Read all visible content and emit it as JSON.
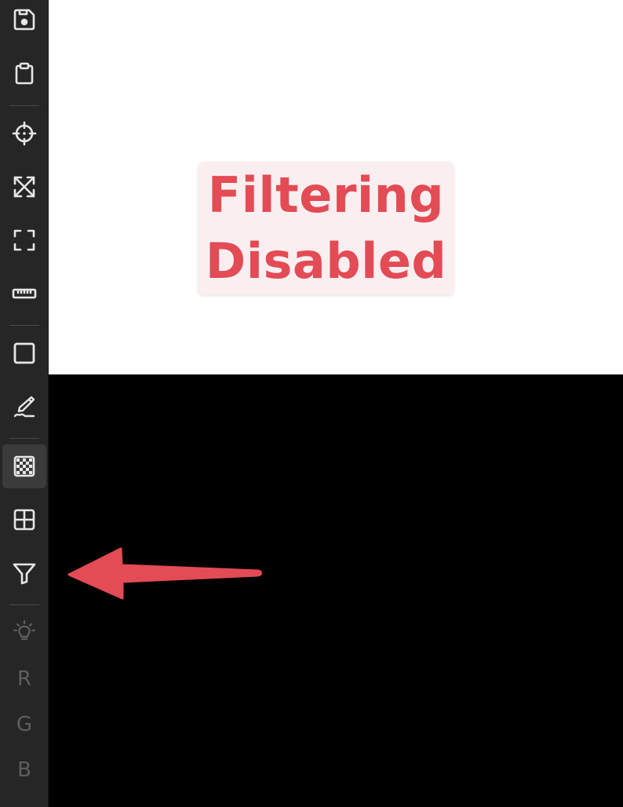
{
  "colors": {
    "toolbar_bg": "#262626",
    "icon": "#e6e6e6",
    "icon_disabled": "#5e5e5e",
    "active_tool_bg": "#3b3b3b",
    "canvas_top": "#ffffff",
    "canvas_bottom": "#000000",
    "notice_bg": "#fbeef0",
    "notice_text": "#e34b55",
    "arrow": "#e34b55"
  },
  "toolbar": {
    "tools": [
      {
        "icon": "save-icon"
      },
      {
        "icon": "clipboard-icon"
      },
      {
        "icon": "crosshair-icon"
      },
      {
        "icon": "expand-arrows-icon"
      },
      {
        "icon": "fullscreen-corners-icon"
      },
      {
        "icon": "ruler-icon"
      },
      {
        "icon": "square-icon"
      },
      {
        "icon": "pen-signature-icon"
      },
      {
        "icon": "checkerboard-icon",
        "active": true
      },
      {
        "icon": "grid-icon"
      },
      {
        "icon": "filter-icon"
      },
      {
        "icon": "lightbulb-icon",
        "disabled": true
      }
    ],
    "channels": [
      {
        "label": "R"
      },
      {
        "label": "G"
      },
      {
        "label": "B"
      }
    ]
  },
  "notice": {
    "line1": "Filtering",
    "line2": "Disabled"
  },
  "annotation": {
    "icon": "arrow-left-icon",
    "points_to": "filter-icon"
  }
}
